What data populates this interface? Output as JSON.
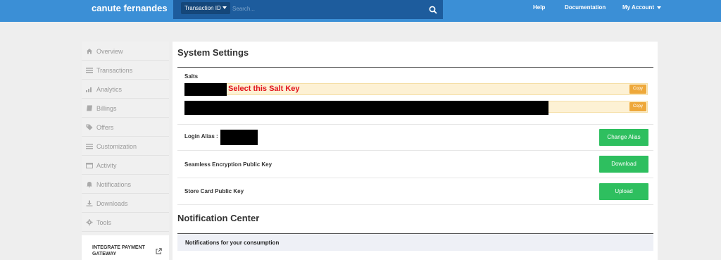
{
  "header": {
    "brand": "canute fernandes",
    "search_type": "Transaction ID",
    "search_placeholder": "Search...",
    "help": "Help",
    "documentation": "Documentation",
    "account": "My Account"
  },
  "sidebar": {
    "items": [
      {
        "label": "Overview",
        "icon": "home-icon"
      },
      {
        "label": "Transactions",
        "icon": "list-icon"
      },
      {
        "label": "Analytics",
        "icon": "bar-chart-icon"
      },
      {
        "label": "Billings",
        "icon": "book-icon"
      },
      {
        "label": "Offers",
        "icon": "tag-icon"
      },
      {
        "label": "Customization",
        "icon": "sliders-icon"
      },
      {
        "label": "Activity",
        "icon": "calendar-icon"
      },
      {
        "label": "Notifications",
        "icon": "bell-icon"
      },
      {
        "label": "Downloads",
        "icon": "download-icon"
      },
      {
        "label": "Tools",
        "icon": "gear-icon"
      }
    ],
    "integrate_label": "INTEGRATE PAYMENT GATEWAY"
  },
  "main": {
    "system_settings_title": "System Settings",
    "salts_label": "Salts",
    "salt_annotation": "Select this Salt Key",
    "copy_label": "Copy",
    "login_alias_label": "Login Alias :",
    "change_alias_button": "Change Alias",
    "encryption_key_label": "Seamless Encryption Public Key",
    "download_button": "Download",
    "store_card_label": "Store Card Public Key",
    "upload_button": "Upload",
    "notification_center_title": "Notification Center",
    "notifications_subtitle": "Notifications for your consumption"
  },
  "colors": {
    "topbar": "#3b8fd6",
    "search_bg": "#1d5c9d",
    "green": "#2ebf5f",
    "copy_orange": "#eea83a",
    "annotation_red": "#e1121b",
    "salt_bg": "#fdf1d4"
  }
}
